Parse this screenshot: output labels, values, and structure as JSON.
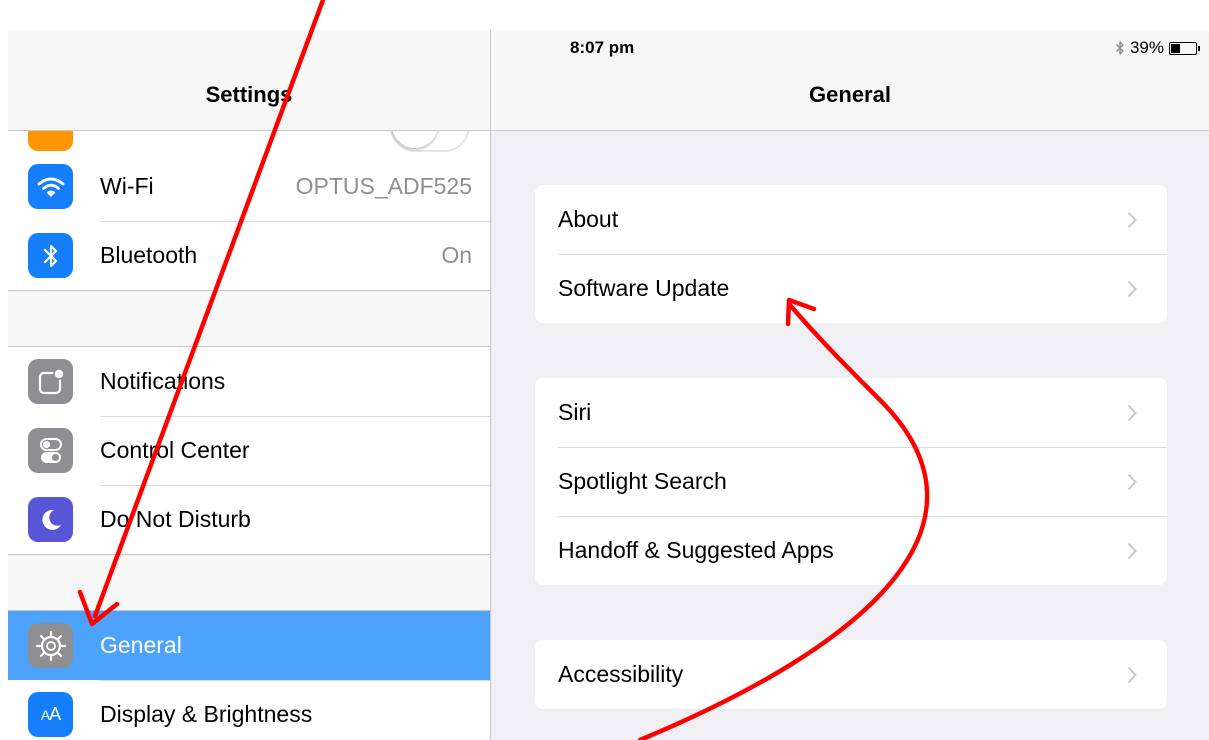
{
  "status_bar": {
    "device": "iPad",
    "time": "8:07 pm",
    "battery": "39%",
    "battery_level": 0.39
  },
  "left": {
    "title": "Settings",
    "groups": [
      [
        {
          "label": "Wi-Fi",
          "value": "OPTUS_ADF525",
          "icon": "wifi-icon",
          "color": "#147efb"
        },
        {
          "label": "Bluetooth",
          "value": "On",
          "icon": "bluetooth-icon",
          "color": "#147efb"
        }
      ],
      [
        {
          "label": "Notifications",
          "icon": "notifications-icon",
          "color": "#8e8e93"
        },
        {
          "label": "Control Center",
          "icon": "control-center-icon",
          "color": "#8e8e93"
        },
        {
          "label": "Do Not Disturb",
          "icon": "moon-icon",
          "color": "#5856d6"
        }
      ],
      [
        {
          "label": "General",
          "icon": "gear-icon",
          "color": "#8e8e93",
          "selected": true
        },
        {
          "label": "Display & Brightness",
          "icon": "display-brightness-icon",
          "color": "#147efb"
        }
      ]
    ]
  },
  "right": {
    "title": "General",
    "groups": [
      [
        "About",
        "Software Update"
      ],
      [
        "Siri",
        "Spotlight Search",
        "Handoff & Suggested Apps"
      ],
      [
        "Accessibility"
      ]
    ]
  },
  "colors": {
    "accent": "#147efb",
    "selection": "#4da2fb",
    "annotation": "#ff0000"
  }
}
